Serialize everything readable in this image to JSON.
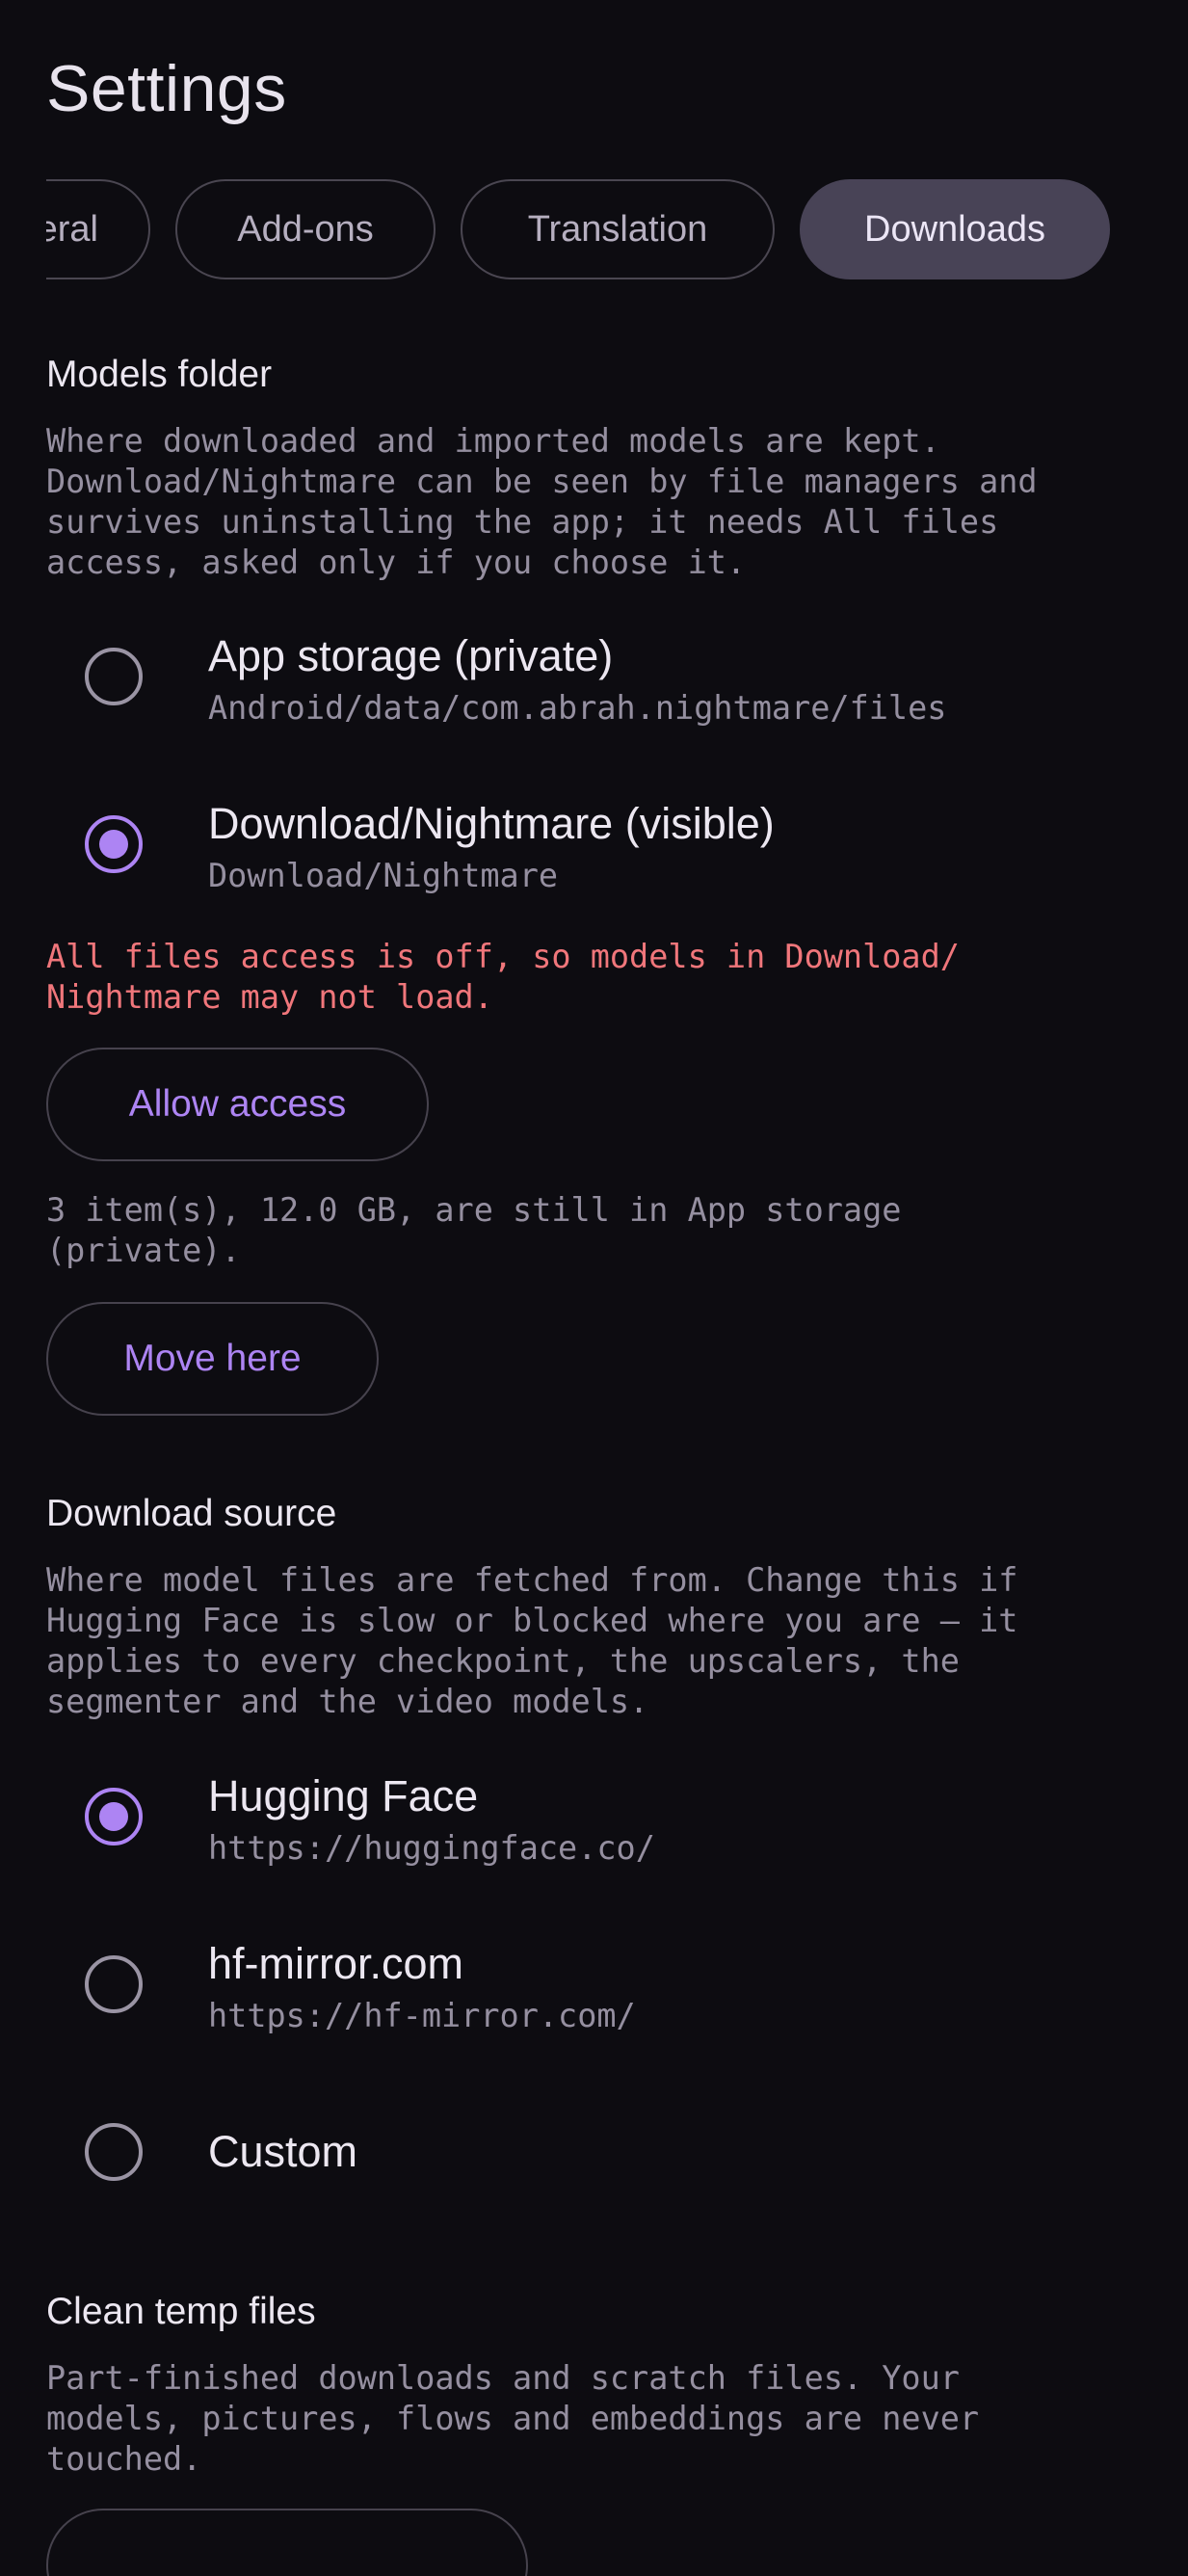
{
  "page": {
    "title": "Settings"
  },
  "tabs": [
    {
      "label": "General",
      "visible_label": "neral",
      "active": false
    },
    {
      "label": "Add-ons",
      "active": false
    },
    {
      "label": "Translation",
      "active": false
    },
    {
      "label": "Downloads",
      "active": true
    }
  ],
  "models_folder": {
    "heading": "Models folder",
    "description": "Where downloaded and imported models are kept.\nDownload/Nightmare can be seen by file managers and\nsurvives uninstalling the app; it needs All files\naccess, asked only if you choose it.",
    "options": [
      {
        "label": "App storage (private)",
        "sub": "Android/data/com.abrah.nightmare/files",
        "selected": false
      },
      {
        "label": "Download/Nightmare (visible)",
        "sub": "Download/Nightmare",
        "selected": true
      }
    ],
    "warning": "All files access is off, so models in Download/\nNightmare may not load.",
    "allow_access_label": "Allow access",
    "remaining_note": "3 item(s), 12.0 GB, are still in App storage\n(private).",
    "move_here_label": "Move here"
  },
  "download_source": {
    "heading": "Download source",
    "description": "Where model files are fetched from. Change this if\nHugging Face is slow or blocked where you are — it\napplies to every checkpoint, the upscalers, the\nsegmenter and the video models.",
    "options": [
      {
        "label": "Hugging Face",
        "sub": "https://huggingface.co/",
        "selected": true
      },
      {
        "label": "hf-mirror.com",
        "sub": "https://hf-mirror.com/",
        "selected": false
      },
      {
        "label": "Custom",
        "sub": "",
        "selected": false
      }
    ]
  },
  "clean_temp": {
    "heading": "Clean temp files",
    "description": "Part-finished downloads and scratch files. Your\nmodels, pictures, flows and embeddings are never\ntouched."
  },
  "colors": {
    "background": "#0d0c11",
    "accent": "#ad84f3",
    "warning": "#f0767b",
    "active_tab": "#484356"
  }
}
